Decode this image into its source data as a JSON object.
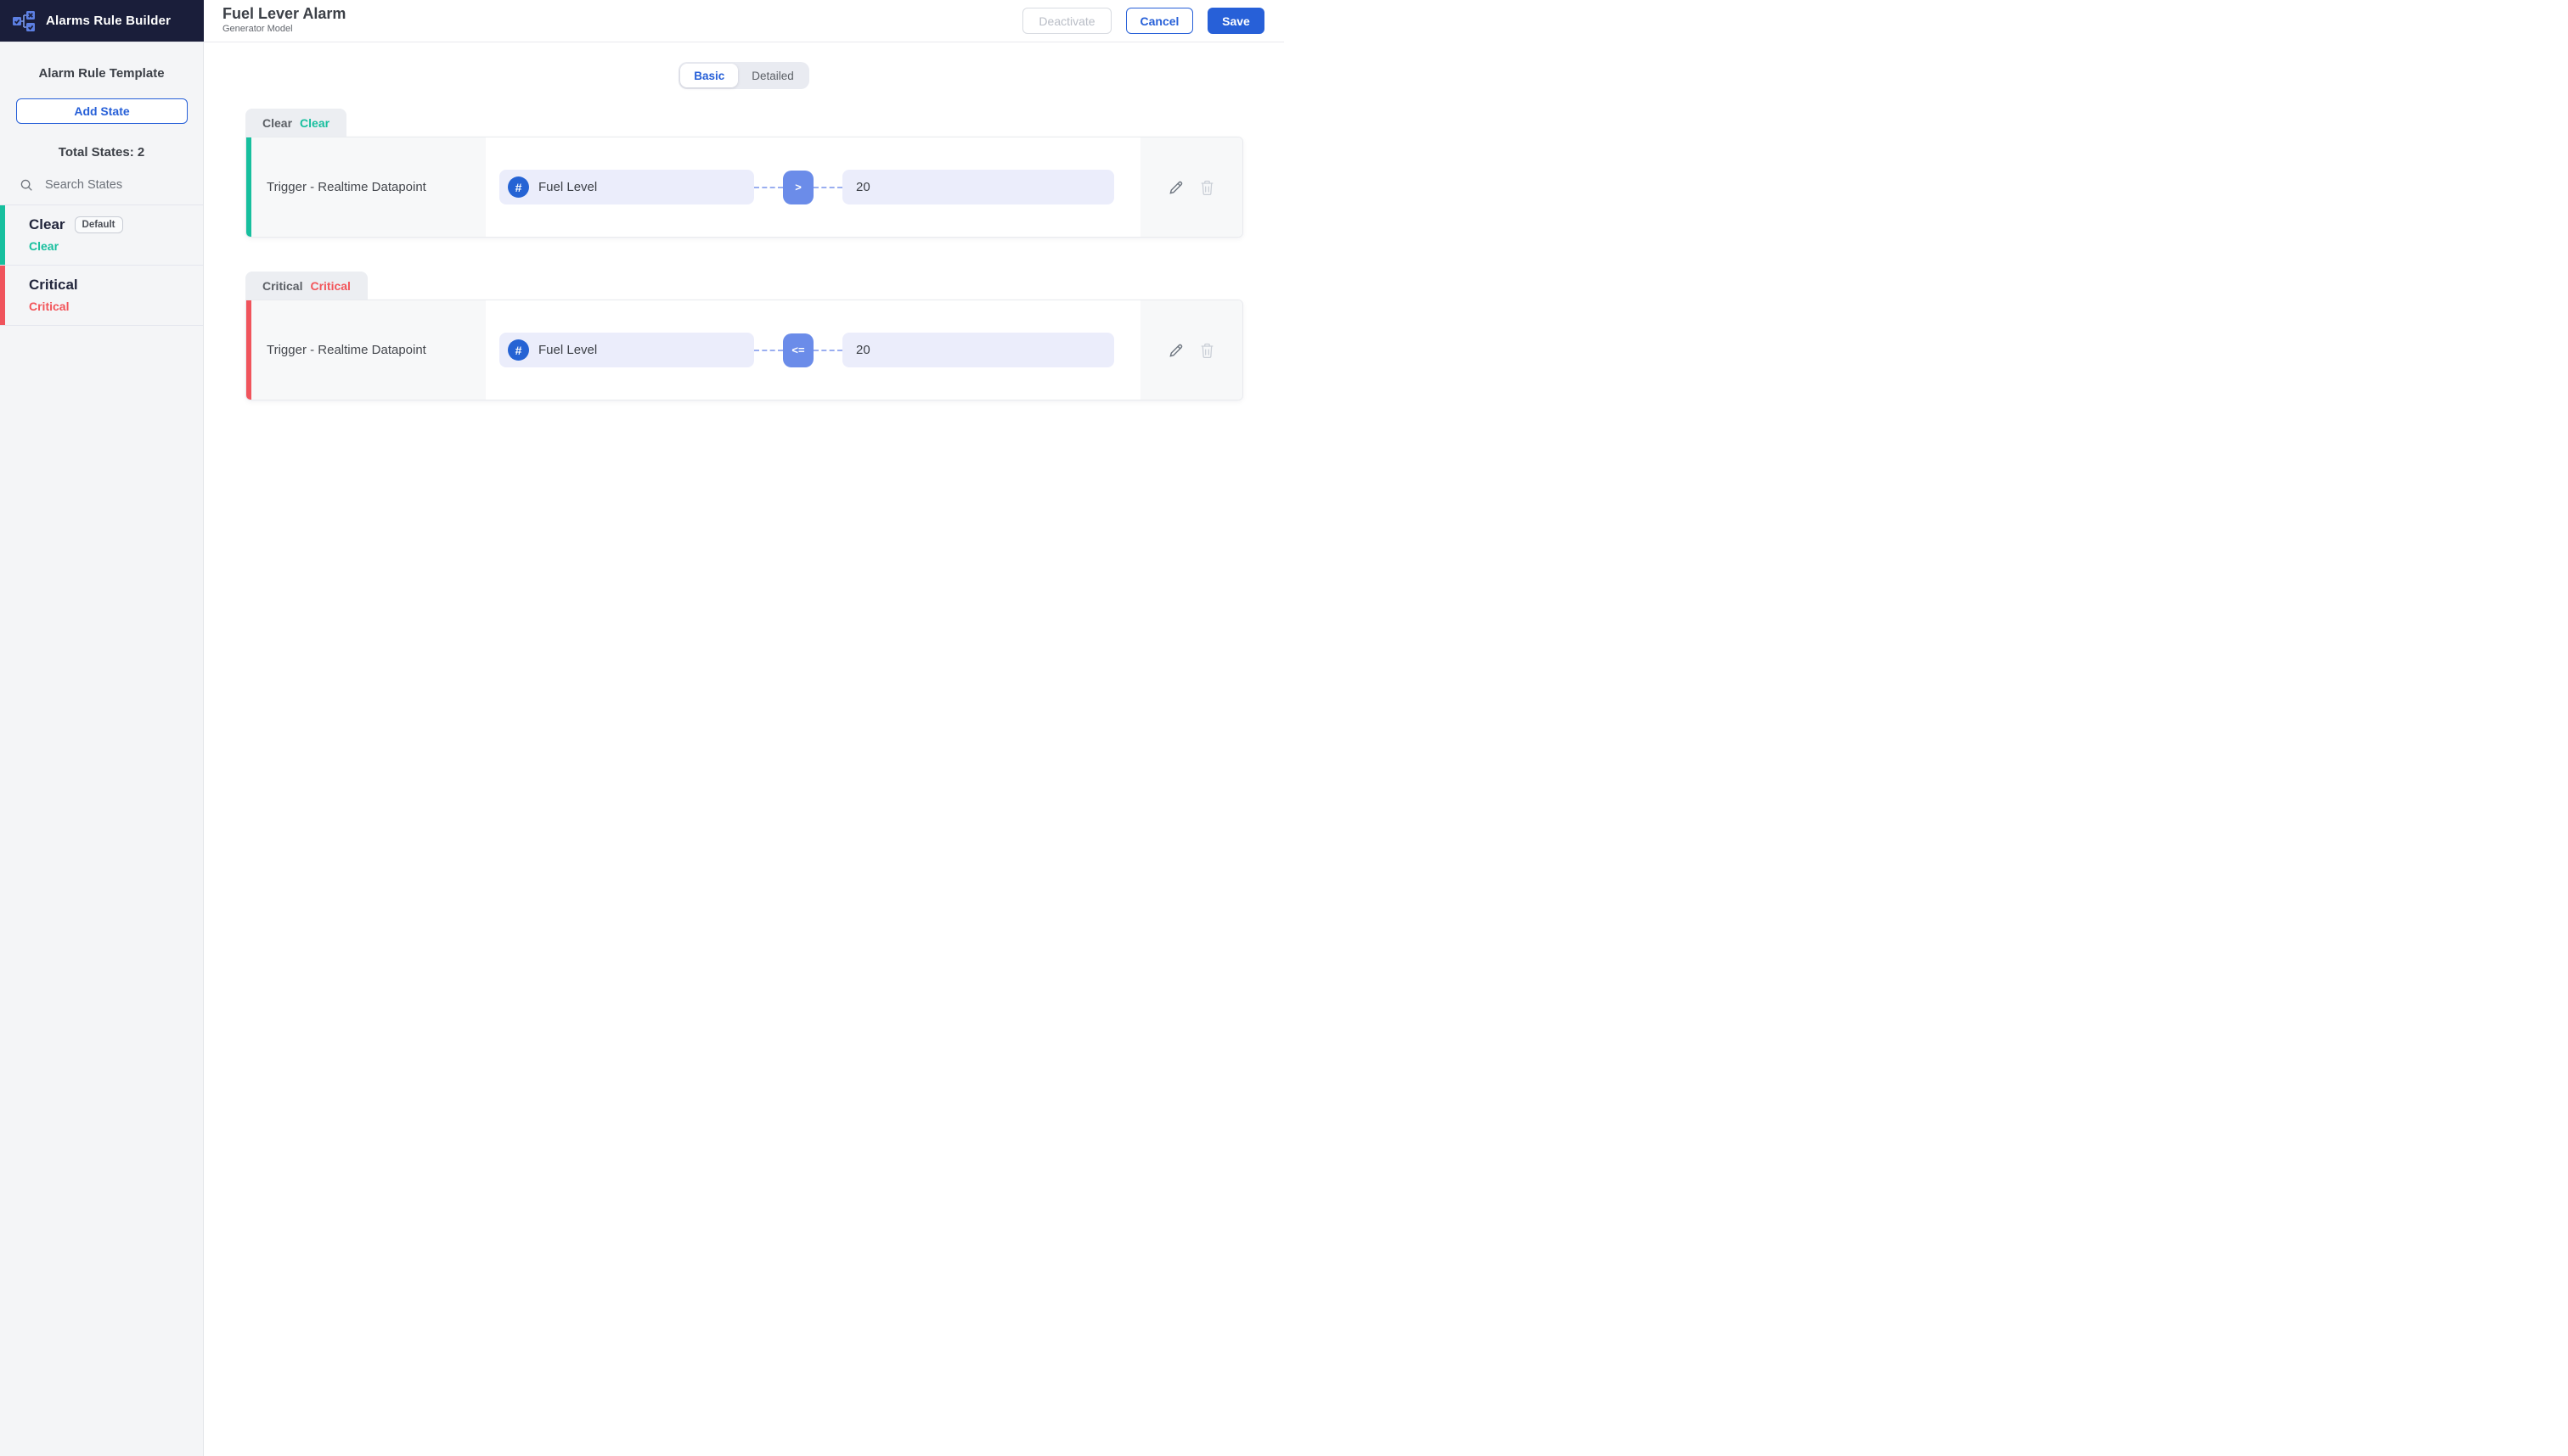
{
  "app": {
    "title": "Alarms Rule Builder"
  },
  "header": {
    "title": "Fuel Lever Alarm",
    "subtitle": "Generator Model",
    "deactivate_label": "Deactivate",
    "cancel_label": "Cancel",
    "save_label": "Save"
  },
  "sidebar": {
    "section_title": "Alarm Rule Template",
    "add_state_label": "Add State",
    "total_states_label": "Total States: 2",
    "search_placeholder": "Search States",
    "states": [
      {
        "name": "Clear",
        "badge": "Default",
        "status_label": "Clear",
        "accent_color": "#17bf9e",
        "status_color": "#17bf9e"
      },
      {
        "name": "Critical",
        "status_label": "Critical",
        "accent_color": "#f0545c",
        "status_color": "#f2555a"
      }
    ]
  },
  "view_toggle": {
    "basic_label": "Basic",
    "detailed_label": "Detailed",
    "selected": "Basic"
  },
  "rules": [
    {
      "tab_name": "Clear",
      "tab_status": "Clear",
      "accent_color": "#17bf9e",
      "status_color": "#17bf9e",
      "trigger_label": "Trigger - Realtime Datapoint",
      "datapoint_icon": "hash-icon",
      "datapoint_label": "Fuel Level",
      "operator": ">",
      "value": "20"
    },
    {
      "tab_name": "Critical",
      "tab_status": "Critical",
      "accent_color": "#f0545c",
      "status_color": "#f2555a",
      "trigger_label": "Trigger - Realtime Datapoint",
      "datapoint_icon": "hash-icon",
      "datapoint_label": "Fuel Level",
      "operator": "<=",
      "value": "20"
    }
  ],
  "icons": {
    "logo": "flowchart-states-icon",
    "search": "search-icon",
    "hash": "hash-icon",
    "edit": "pencil-icon",
    "delete": "trash-icon"
  },
  "colors": {
    "brand_blue": "#2760d8",
    "operator_blue": "#6b8ce9",
    "navy_header": "#1a1e3a",
    "clear_green": "#17bf9e",
    "critical_red": "#f0545c",
    "pill_lavender": "#ebedfb"
  }
}
